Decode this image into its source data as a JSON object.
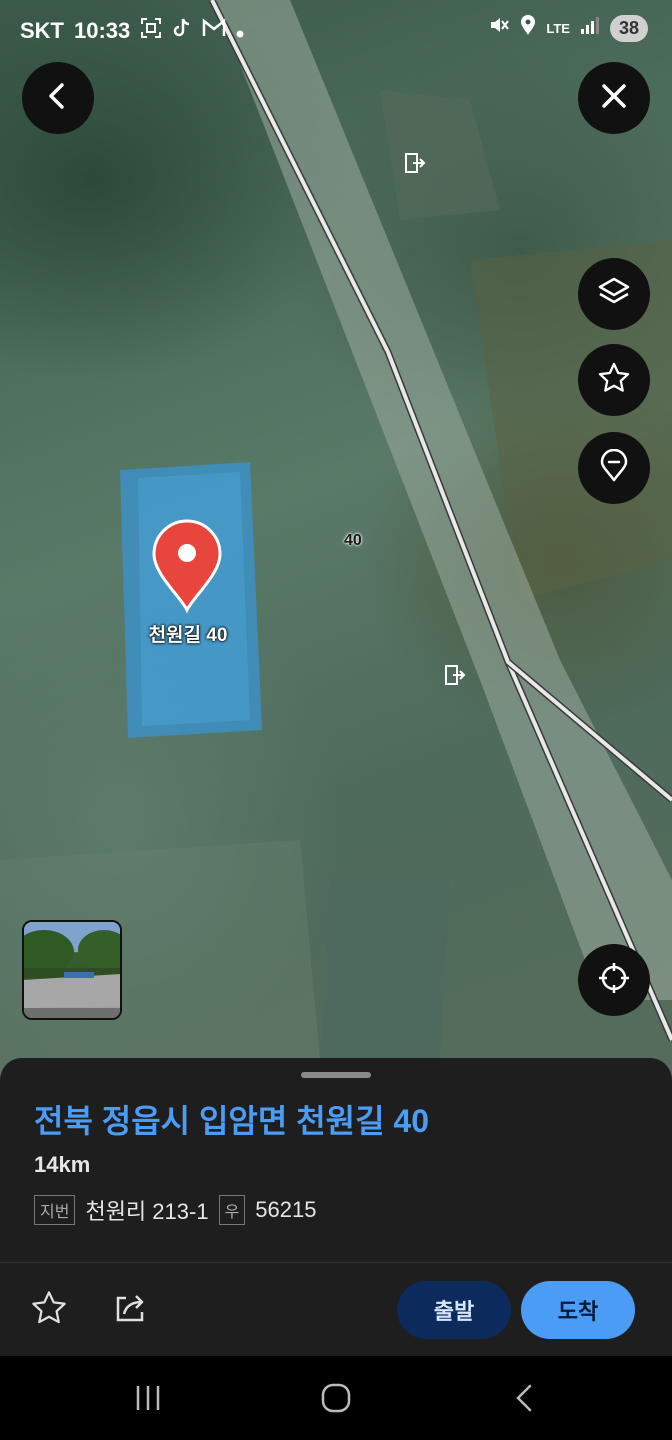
{
  "status_bar": {
    "carrier": "SKT",
    "time": "10:33",
    "battery": "38",
    "network": "LTE"
  },
  "map": {
    "pin_label": "천원길 40",
    "road_number_label": "40",
    "top_buttons": {
      "back": "chevron-left-icon",
      "close": "close-icon"
    },
    "side_buttons": [
      "layers-icon",
      "star-icon",
      "marker-icon"
    ],
    "locate_button": "crosshair-icon"
  },
  "place": {
    "address": "전북 정읍시 입암면 천원길 40",
    "distance": "14km",
    "lot_tag": "지번",
    "lot_number": "천원리 213-1",
    "postal_tag": "우",
    "postal_code": "56215"
  },
  "actions": {
    "depart_label": "출발",
    "arrive_label": "도착"
  },
  "colors": {
    "accent": "#4a9cf5",
    "depart_bg": "#0d2a5c",
    "pin": "#e8453c",
    "sheet_bg": "#1e1e1f"
  }
}
